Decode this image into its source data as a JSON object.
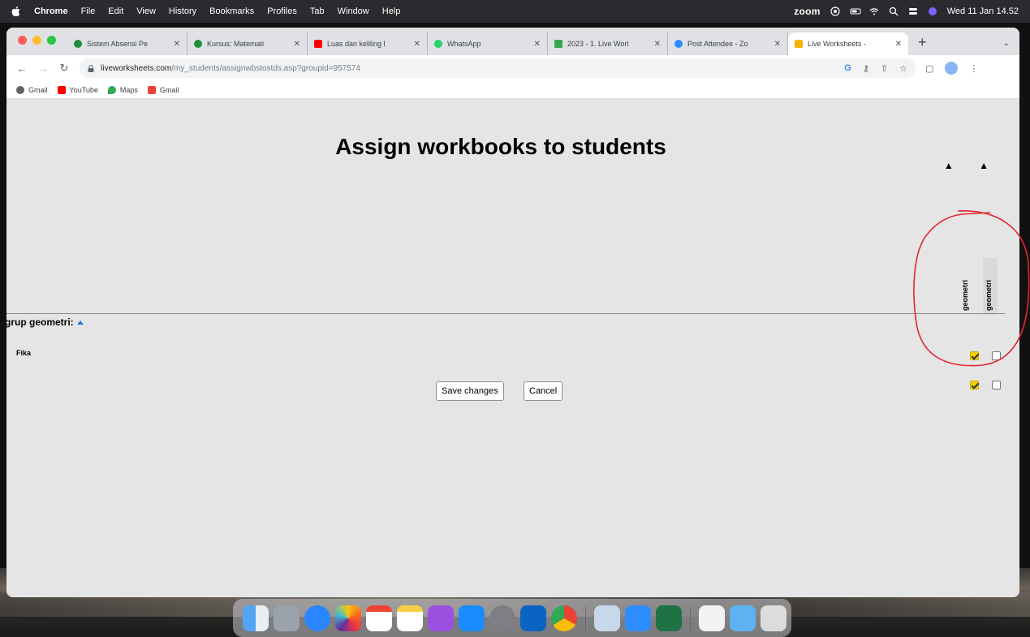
{
  "menubar": {
    "app": "Chrome",
    "items": [
      "File",
      "Edit",
      "View",
      "History",
      "Bookmarks",
      "Profiles",
      "Tab",
      "Window",
      "Help"
    ],
    "zoom": "zoom",
    "clock": "Wed 11 Jan 14.52"
  },
  "tabs": [
    {
      "label": "Sistem Absensi Pe",
      "color": "#1e8e3e"
    },
    {
      "label": "Kursus: Matemati",
      "color": "#1e8e3e"
    },
    {
      "label": "Luas dan keliling l",
      "color": "#ff0000"
    },
    {
      "label": "WhatsApp",
      "color": "#25d366"
    },
    {
      "label": "2023 - 1. Live Worl",
      "color": "#34a853"
    },
    {
      "label": "Post Attendee - Zo",
      "color": "#2d8cff"
    },
    {
      "label": "Live Worksheets - ",
      "color": "#f4b400",
      "active": true
    }
  ],
  "toolbar": {
    "url_host": "liveworksheets.com",
    "url_path": "/my_students/assignwbstostds.asp?groupid=957574"
  },
  "bookmarks": [
    {
      "label": "Gmail",
      "color": "#5f6368"
    },
    {
      "label": "YouTube",
      "color": "#ff0000"
    },
    {
      "label": "Maps",
      "color": "#34a853"
    },
    {
      "label": "Gmail",
      "color": "#ea4335"
    }
  ],
  "page": {
    "title": "Assign workbooks to students",
    "sort_arrows": "▲ ▲",
    "columns": [
      "geometri",
      "geometri"
    ],
    "group": {
      "name": "grup geometri:"
    },
    "students": [
      {
        "name": "Fika",
        "checks": [
          true,
          false
        ]
      }
    ],
    "group_checks": [
      true,
      false
    ],
    "save_label": "Save changes",
    "cancel_label": "Cancel"
  },
  "colors": {
    "annotation": "#e4252e",
    "checked": "#f5d000"
  }
}
